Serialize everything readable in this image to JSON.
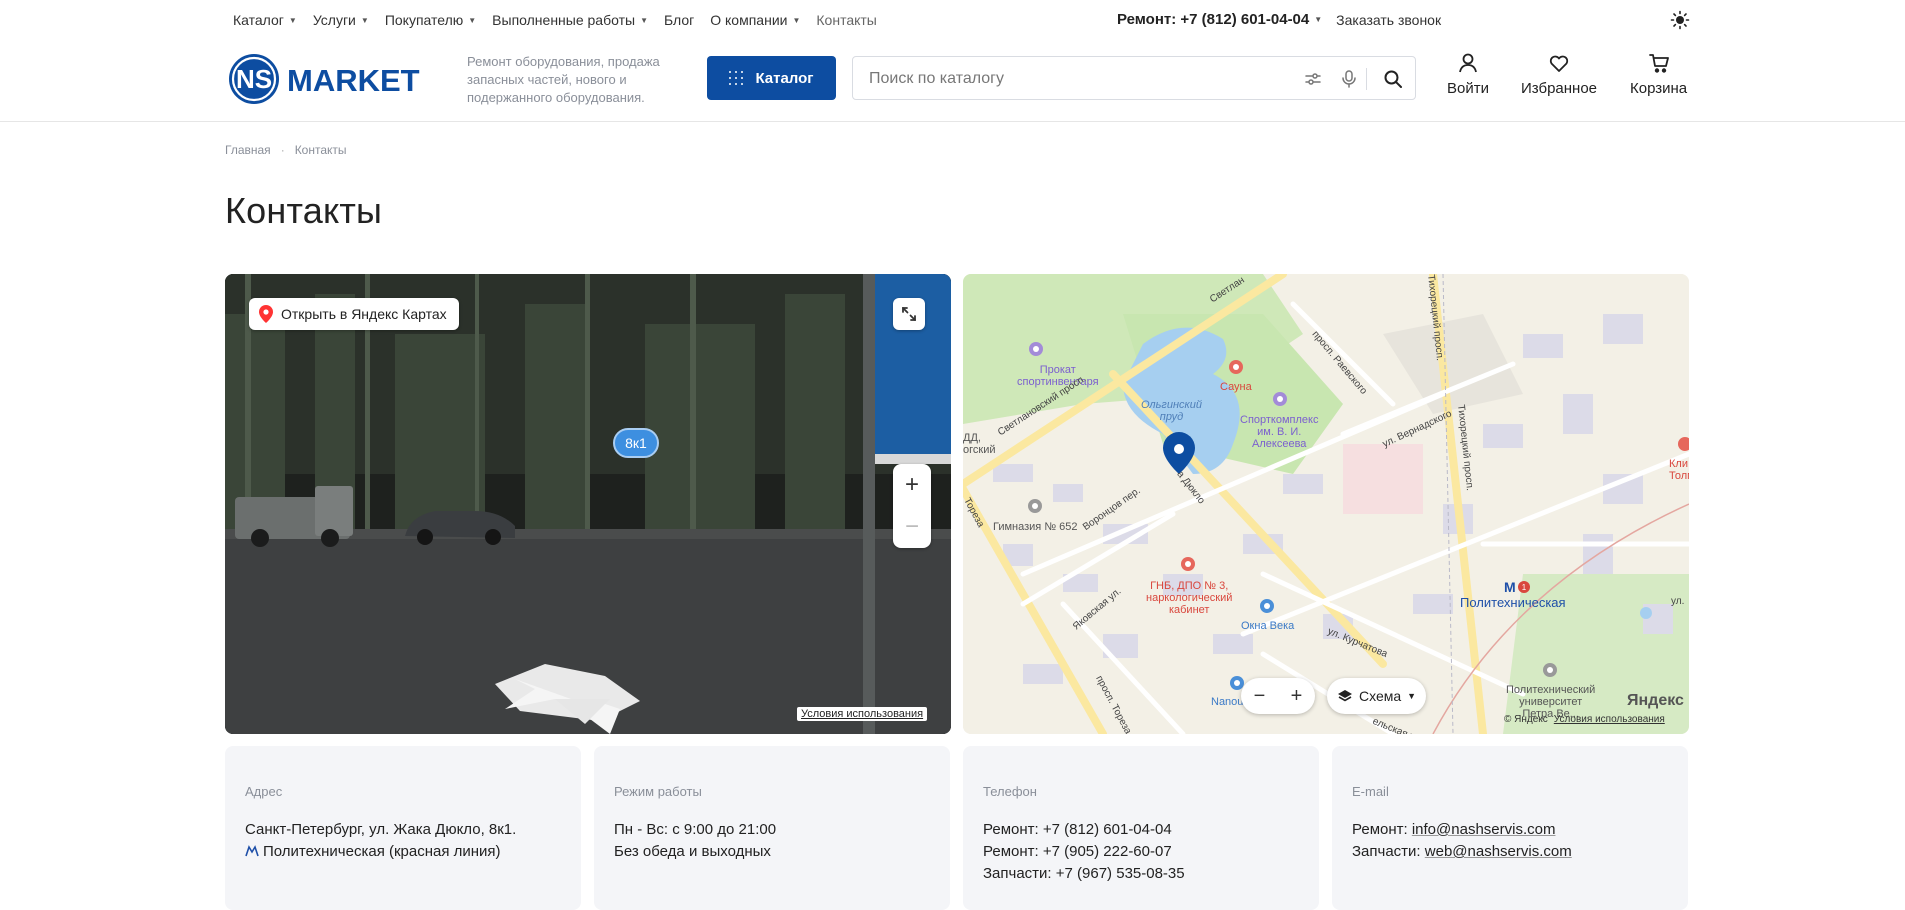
{
  "topnav": {
    "items": [
      {
        "label": "Каталог",
        "dropdown": true
      },
      {
        "label": "Услуги",
        "dropdown": true
      },
      {
        "label": "Покупателю",
        "dropdown": true
      },
      {
        "label": "Выполненные работы",
        "dropdown": true
      },
      {
        "label": "Блог",
        "dropdown": false
      },
      {
        "label": "О компании",
        "dropdown": true
      },
      {
        "label": "Контакты",
        "dropdown": false
      }
    ],
    "phone": "Ремонт: +7 (812) 601-04-04",
    "callback": "Заказать звонок"
  },
  "header": {
    "logo_text_ns": "NS",
    "logo_text_market": "MARKET",
    "tagline": "Ремонт оборудования, продажа запасных частей, нового и подержанного оборудования.",
    "catalog_button": "Каталог",
    "search_placeholder": "Поиск по каталогу",
    "actions": {
      "login": "Войти",
      "favorites": "Избранное",
      "cart": "Корзина"
    }
  },
  "breadcrumb": {
    "home": "Главная",
    "current": "Контакты"
  },
  "page_title": "Контакты",
  "panorama": {
    "open_in_yandex": "Открыть в Яндекс Картах",
    "house_label": "8к1",
    "terms": "Условия использования"
  },
  "map": {
    "labels": {
      "rental": "Прокат\nспортинвентаря",
      "pond": "Ольгинский\nпруд",
      "sauna": "Сауна",
      "sport_complex": "Спорткомплекс\nим. В. И.\nАлексеева",
      "gymnasium": "Гимназия № 652",
      "gnb": "ГНБ, ДПО № 3,\nнаркологический\nкабинет",
      "okna": "Окна Века",
      "metro": "Политехническая",
      "university": "Политехнический\nуниверситет\nПетра Ве...",
      "nanou": "Nanou",
      "klin": "Кли\nТолма",
      "ddsk": "ДД,\nогский",
      "street_svetlanovsky": "Светлановский просп.",
      "street_svetlan_top": "Светлан",
      "street_raevskogo": "просп. Раевского",
      "street_vernadskogo": "ул. Вернадского",
      "street_tikhoretsky1": "Тихорецкий просп.",
      "street_tikhoretsky2": "Тихорецкий просп.",
      "street_duklo": "а Дюкло",
      "street_vorontsov": "Воронцов пер.",
      "street_yakovskaya": "Яковская ул.",
      "street_toreza1": "Тореза",
      "street_toreza2": "просп. Тореза",
      "street_kurchatova": "ул. Курчатова",
      "street_ul": "ул.",
      "street_bottom": "ельская ул."
    },
    "metro_line_number": "1",
    "layer_button": "Схема",
    "yandex_logo": "Яндекс",
    "copyright": "© Яндекс",
    "terms": "Условия использования"
  },
  "cards": {
    "address": {
      "label": "Адрес",
      "line1": "Санкт-Петербург, ул. Жака Дюкло, 8к1.",
      "line2": "Политехническая (красная линия)"
    },
    "hours": {
      "label": "Режим работы",
      "line1": "Пн - Вс: с 9:00 до 21:00",
      "line2": "Без обеда и выходных"
    },
    "phone": {
      "label": "Телефон",
      "line1": "Ремонт: +7 (812) 601-04-04",
      "line2": "Ремонт: +7 (905) 222-60-07",
      "line3": "Запчасти: +7 (967) 535-08-35"
    },
    "email": {
      "label": "E-mail",
      "line1_prefix": "Ремонт: ",
      "line1_link": "info@nashservis.com",
      "line2_prefix": "Запчасти: ",
      "line2_link": "web@nashservis.com"
    }
  },
  "colors": {
    "brand": "#0d4da1",
    "metro_red": "#d9473d",
    "metro_blue": "#1e4fa8"
  }
}
